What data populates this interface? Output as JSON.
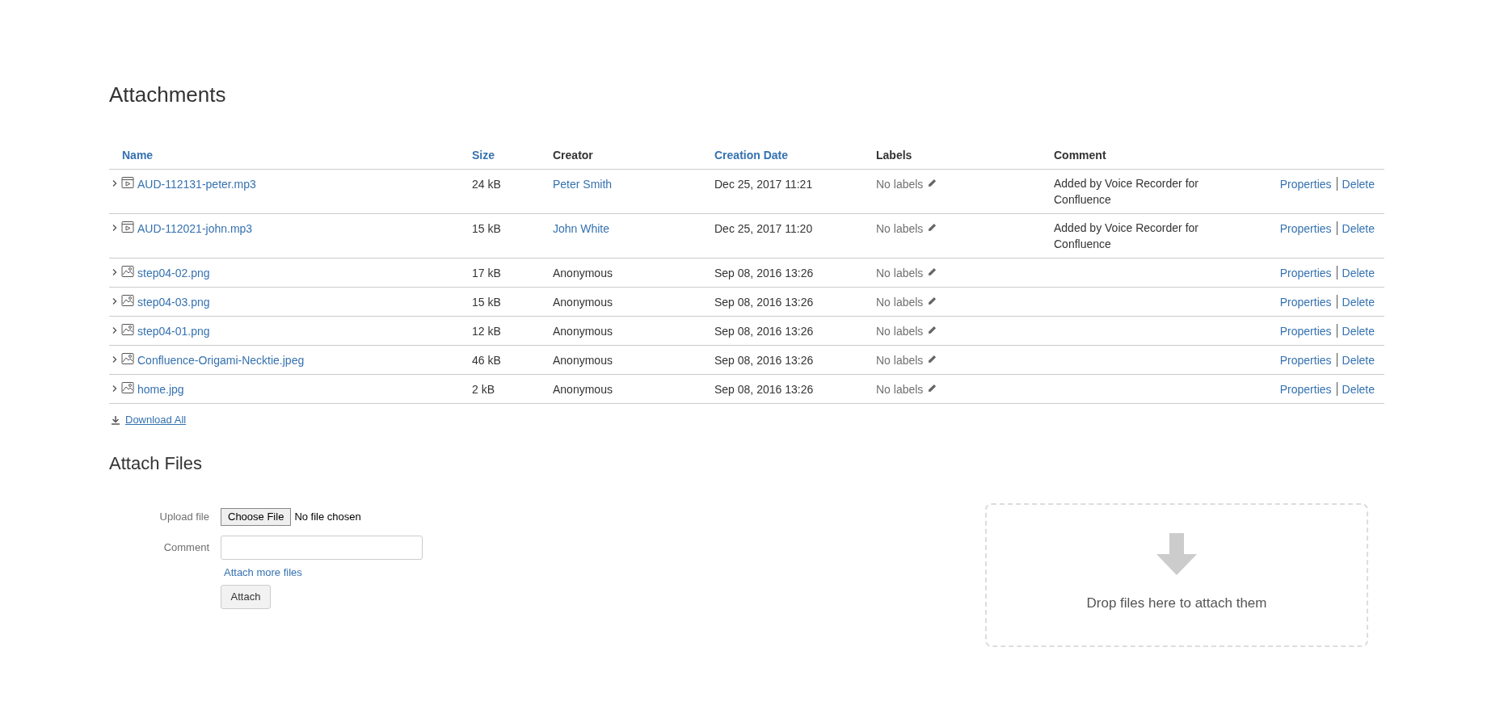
{
  "title": "Attachments",
  "table": {
    "columns": [
      {
        "label": "Name",
        "sortable": true
      },
      {
        "label": "Size",
        "sortable": true
      },
      {
        "label": "Creator",
        "sortable": false
      },
      {
        "label": "Creation Date",
        "sortable": true
      },
      {
        "label": "Labels",
        "sortable": false
      },
      {
        "label": "Comment",
        "sortable": false
      }
    ],
    "rows": [
      {
        "kind": "audio",
        "name": "AUD-112131-peter.mp3",
        "size": "24 kB",
        "creator": "Peter Smith",
        "creator_link": true,
        "date": "Dec 25, 2017 11:21",
        "labels": "No labels",
        "comment": "Added by Voice Recorder for Confluence",
        "actions": [
          "Properties",
          "Delete"
        ]
      },
      {
        "kind": "audio",
        "name": "AUD-112021-john.mp3",
        "size": "15 kB",
        "creator": "John White",
        "creator_link": true,
        "date": "Dec 25, 2017 11:20",
        "labels": "No labels",
        "comment": "Added by Voice Recorder for Confluence",
        "actions": [
          "Properties",
          "Delete"
        ]
      },
      {
        "kind": "image",
        "name": "step04-02.png",
        "size": "17 kB",
        "creator": "Anonymous",
        "creator_link": false,
        "date": "Sep 08, 2016 13:26",
        "labels": "No labels",
        "actions": [
          "Properties",
          "Delete"
        ]
      },
      {
        "kind": "image",
        "name": "step04-03.png",
        "size": "15 kB",
        "creator": "Anonymous",
        "creator_link": false,
        "date": "Sep 08, 2016 13:26",
        "labels": "No labels",
        "actions": [
          "Properties",
          "Delete"
        ]
      },
      {
        "kind": "image",
        "name": "step04-01.png",
        "size": "12 kB",
        "creator": "Anonymous",
        "creator_link": false,
        "date": "Sep 08, 2016 13:26",
        "labels": "No labels",
        "actions": [
          "Properties",
          "Delete"
        ]
      },
      {
        "kind": "image",
        "name": "Confluence-Origami-Necktie.jpeg",
        "size": "46 kB",
        "creator": "Anonymous",
        "creator_link": false,
        "date": "Sep 08, 2016 13:26",
        "labels": "No labels",
        "actions": [
          "Properties",
          "Delete"
        ]
      },
      {
        "kind": "image",
        "name": "home.jpg",
        "size": "2 kB",
        "creator": "Anonymous",
        "creator_link": false,
        "date": "Sep 08, 2016 13:26",
        "labels": "No labels",
        "actions": [
          "Properties",
          "Delete"
        ]
      }
    ]
  },
  "download_all": "Download All",
  "attach": {
    "title": "Attach Files",
    "upload_label": "Upload file",
    "choose_button": "Choose File",
    "file_status": "No file chosen",
    "comment_label": "Comment",
    "more_link": "Attach more files",
    "submit": "Attach",
    "drop_text": "Drop files here to attach them"
  }
}
